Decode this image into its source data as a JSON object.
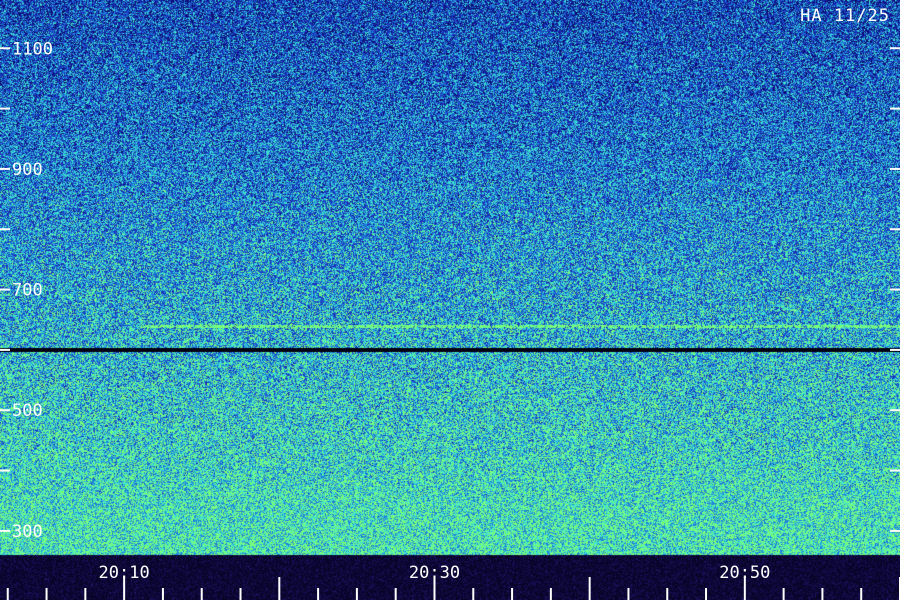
{
  "chart_data": {
    "type": "heatmap",
    "title": "HA 11/25",
    "x_ticks": [
      {
        "label": "20:10",
        "minutes": 10
      },
      {
        "label": "20:30",
        "minutes": 30
      },
      {
        "label": "20:50",
        "minutes": 50
      }
    ],
    "x_range_minutes": [
      2,
      60
    ],
    "y_ticks": [
      {
        "label": "1100",
        "value": 1100
      },
      {
        "label": "900",
        "value": 900
      },
      {
        "label": "700",
        "value": 700
      },
      {
        "label": "500",
        "value": 500
      },
      {
        "label": "300",
        "value": 300
      }
    ],
    "y_range": [
      260,
      1180
    ],
    "colormap": [
      "#000010",
      "#0a0a6e",
      "#1a2fb8",
      "#1f7fd8",
      "#3fe0d0",
      "#7aff7a"
    ],
    "features": [
      {
        "kind": "bright-line",
        "value": 640,
        "color": "#7aff7a"
      },
      {
        "kind": "dark-gap",
        "value": 600,
        "color": "#000008"
      }
    ]
  }
}
